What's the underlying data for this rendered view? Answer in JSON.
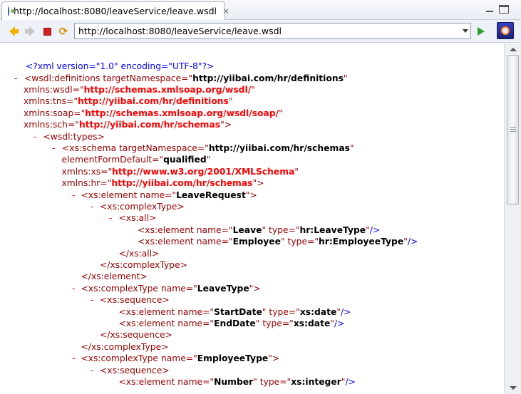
{
  "tab": {
    "title": "http://localhost:8080/leaveService/leave.wsdl",
    "close": "✕"
  },
  "toolbar": {
    "url": "http://localhost:8080/leaveService/leave.wsdl"
  },
  "xml": {
    "decl": "<?xml version=\"1.0\" encoding=\"UTF-8\"?>",
    "lines": [
      {
        "minus": true,
        "indent": 0,
        "parts": [
          [
            "tag",
            "<wsdl:definitions "
          ],
          [
            "attr",
            "targetNamespace"
          ],
          [
            "eq",
            "=\""
          ],
          [
            "val",
            "http://yiibai.com/hr/definitions"
          ],
          [
            "q",
            "\""
          ]
        ]
      },
      {
        "minus": false,
        "indent": 0,
        "parts": [
          [
            "attr",
            "xmlns:wsdl"
          ],
          [
            "eq",
            "=\""
          ],
          [
            "nsval",
            "http://schemas.xmlsoap.org/wsdl/"
          ],
          [
            "q",
            "\""
          ]
        ]
      },
      {
        "minus": false,
        "indent": 0,
        "parts": [
          [
            "attr",
            "xmlns:tns"
          ],
          [
            "eq",
            "=\""
          ],
          [
            "nsval",
            "http://yiibai.com/hr/definitions"
          ],
          [
            "q",
            "\""
          ]
        ]
      },
      {
        "minus": false,
        "indent": 0,
        "parts": [
          [
            "attr",
            "xmlns:soap"
          ],
          [
            "eq",
            "=\""
          ],
          [
            "nsval",
            "http://schemas.xmlsoap.org/wsdl/soap/"
          ],
          [
            "q",
            "\""
          ]
        ]
      },
      {
        "minus": false,
        "indent": 0,
        "parts": [
          [
            "attr",
            "xmlns:sch"
          ],
          [
            "eq",
            "=\""
          ],
          [
            "nsval",
            "http://yiibai.com/hr/schemas"
          ],
          [
            "q",
            "\">"
          ]
        ]
      },
      {
        "minus": true,
        "indent": 1,
        "parts": [
          [
            "tag",
            "<wsdl:types>"
          ]
        ]
      },
      {
        "minus": true,
        "indent": 2,
        "parts": [
          [
            "tag",
            "<xs:schema "
          ],
          [
            "attr",
            "targetNamespace"
          ],
          [
            "eq",
            "=\""
          ],
          [
            "val",
            "http://yiibai.com/hr/schemas"
          ],
          [
            "q",
            "\""
          ]
        ]
      },
      {
        "minus": false,
        "indent": 2,
        "parts": [
          [
            "attr",
            "elementFormDefault"
          ],
          [
            "eq",
            "=\""
          ],
          [
            "val",
            "qualified"
          ],
          [
            "q",
            "\""
          ]
        ]
      },
      {
        "minus": false,
        "indent": 2,
        "parts": [
          [
            "attr",
            "xmlns:xs"
          ],
          [
            "eq",
            "=\""
          ],
          [
            "nsval",
            "http://www.w3.org/2001/XMLSchema"
          ],
          [
            "q",
            "\""
          ]
        ]
      },
      {
        "minus": false,
        "indent": 2,
        "parts": [
          [
            "attr",
            "xmlns:hr"
          ],
          [
            "eq",
            "=\""
          ],
          [
            "nsval",
            "http://yiibai.com/hr/schemas"
          ],
          [
            "q",
            "\">"
          ]
        ]
      },
      {
        "minus": true,
        "indent": 3,
        "parts": [
          [
            "tag",
            "<xs:element "
          ],
          [
            "attr",
            "name"
          ],
          [
            "eq",
            "=\""
          ],
          [
            "val",
            "LeaveRequest"
          ],
          [
            "q",
            "\">"
          ]
        ]
      },
      {
        "minus": true,
        "indent": 4,
        "parts": [
          [
            "tag",
            "<xs:complexType>"
          ]
        ]
      },
      {
        "minus": true,
        "indent": 5,
        "parts": [
          [
            "tag",
            "<xs:all>"
          ]
        ]
      },
      {
        "minus": false,
        "indent": 6,
        "parts": [
          [
            "tag",
            "<xs:element "
          ],
          [
            "attr",
            "name"
          ],
          [
            "eq",
            "=\""
          ],
          [
            "val",
            "Leave"
          ],
          [
            "q",
            "\" "
          ],
          [
            "attr",
            "type"
          ],
          [
            "eq",
            "=\""
          ],
          [
            "val",
            "hr:LeaveType"
          ],
          [
            "q",
            "\""
          ],
          [
            "blue",
            "/>"
          ]
        ]
      },
      {
        "minus": false,
        "indent": 6,
        "parts": [
          [
            "tag",
            "<xs:element "
          ],
          [
            "attr",
            "name"
          ],
          [
            "eq",
            "=\""
          ],
          [
            "val",
            "Employee"
          ],
          [
            "q",
            "\" "
          ],
          [
            "attr",
            "type"
          ],
          [
            "eq",
            "=\""
          ],
          [
            "val",
            "hr:EmployeeType"
          ],
          [
            "q",
            "\""
          ],
          [
            "blue",
            "/>"
          ]
        ]
      },
      {
        "minus": false,
        "indent": 5,
        "parts": [
          [
            "tag",
            "</xs:all>"
          ]
        ]
      },
      {
        "minus": false,
        "indent": 4,
        "parts": [
          [
            "tag",
            "</xs:complexType>"
          ]
        ]
      },
      {
        "minus": false,
        "indent": 3,
        "parts": [
          [
            "tag",
            "</xs:element>"
          ]
        ]
      },
      {
        "minus": true,
        "indent": 3,
        "parts": [
          [
            "tag",
            "<xs:complexType "
          ],
          [
            "attr",
            "name"
          ],
          [
            "eq",
            "=\""
          ],
          [
            "val",
            "LeaveType"
          ],
          [
            "q",
            "\">"
          ]
        ]
      },
      {
        "minus": true,
        "indent": 4,
        "parts": [
          [
            "tag",
            "<xs:sequence>"
          ]
        ]
      },
      {
        "minus": false,
        "indent": 5,
        "parts": [
          [
            "tag",
            "<xs:element "
          ],
          [
            "attr",
            "name"
          ],
          [
            "eq",
            "=\""
          ],
          [
            "val",
            "StartDate"
          ],
          [
            "q",
            "\" "
          ],
          [
            "attr",
            "type"
          ],
          [
            "eq",
            "=\""
          ],
          [
            "val",
            "xs:date"
          ],
          [
            "q",
            "\""
          ],
          [
            "blue",
            "/>"
          ]
        ]
      },
      {
        "minus": false,
        "indent": 5,
        "parts": [
          [
            "tag",
            "<xs:element "
          ],
          [
            "attr",
            "name"
          ],
          [
            "eq",
            "=\""
          ],
          [
            "val",
            "EndDate"
          ],
          [
            "q",
            "\" "
          ],
          [
            "attr",
            "type"
          ],
          [
            "eq",
            "=\""
          ],
          [
            "val",
            "xs:date"
          ],
          [
            "q",
            "\""
          ],
          [
            "blue",
            "/>"
          ]
        ]
      },
      {
        "minus": false,
        "indent": 4,
        "parts": [
          [
            "tag",
            "</xs:sequence>"
          ]
        ]
      },
      {
        "minus": false,
        "indent": 3,
        "parts": [
          [
            "tag",
            "</xs:complexType>"
          ]
        ]
      },
      {
        "minus": true,
        "indent": 3,
        "parts": [
          [
            "tag",
            "<xs:complexType "
          ],
          [
            "attr",
            "name"
          ],
          [
            "eq",
            "=\""
          ],
          [
            "val",
            "EmployeeType"
          ],
          [
            "q",
            "\">"
          ]
        ]
      },
      {
        "minus": true,
        "indent": 4,
        "parts": [
          [
            "tag",
            "<xs:sequence>"
          ]
        ]
      },
      {
        "minus": false,
        "indent": 5,
        "parts": [
          [
            "tag",
            "<xs:element "
          ],
          [
            "attr",
            "name"
          ],
          [
            "eq",
            "=\""
          ],
          [
            "val",
            "Number"
          ],
          [
            "q",
            "\" "
          ],
          [
            "attr",
            "type"
          ],
          [
            "eq",
            "=\""
          ],
          [
            "val",
            "xs:integer"
          ],
          [
            "q",
            "\""
          ],
          [
            "blue",
            "/>"
          ]
        ]
      }
    ]
  }
}
